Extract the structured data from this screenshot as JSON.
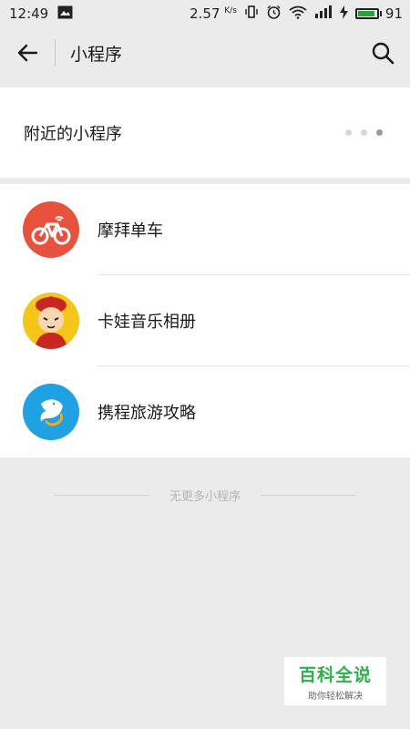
{
  "status_bar": {
    "time": "12:49",
    "network_speed": "2.57",
    "network_unit": "K/s",
    "battery": "91"
  },
  "nav": {
    "title": "小程序"
  },
  "nearby": {
    "label": "附近的小程序"
  },
  "apps": [
    {
      "name": "摩拜单车",
      "icon": "bike-icon",
      "color": "#e8513c"
    },
    {
      "name": "卡娃音乐相册",
      "icon": "cartoon-boy-icon",
      "color": "#f5c518"
    },
    {
      "name": "携程旅游攻略",
      "icon": "dolphin-icon",
      "color": "#1ea2e4"
    }
  ],
  "footer": {
    "text": "无更多小程序"
  },
  "watermark": {
    "title": "百科全说",
    "subtitle": "助你轻松解决"
  }
}
